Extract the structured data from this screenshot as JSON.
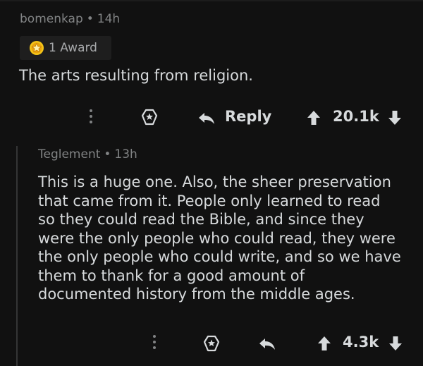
{
  "colors": {
    "background": "#111111",
    "text": "#d7dadc",
    "muted": "#818384",
    "award_badge": "#f5c518",
    "thread_line": "#343536"
  },
  "comment_1": {
    "author": "bomenkap",
    "separator": "•",
    "age": "14h",
    "award_label": "1 Award",
    "award_icon": "star-award-icon",
    "body": "The arts resulting from religion.",
    "actions": {
      "more_icon": "more-vertical-icon",
      "award_icon": "give-award-icon",
      "reply_icon": "reply-arrow-icon",
      "reply_label": "Reply",
      "upvote_icon": "upvote-arrow-icon",
      "score": "20.1k",
      "downvote_icon": "downvote-arrow-icon"
    }
  },
  "comment_2": {
    "author": "Teglement",
    "separator": "•",
    "age": "13h",
    "body_lines": [
      "This is a huge one.  Also, the sheer preservation",
      "that came from it.  People only learned to read",
      "so they could read the Bible, and since they",
      "were the only people who could read, they were",
      "the only people who could write, and so we have",
      "them to thank for a good amount of",
      "documented history from the middle ages."
    ],
    "actions": {
      "more_icon": "more-vertical-icon",
      "award_icon": "give-award-icon",
      "reply_icon": "reply-arrow-icon",
      "upvote_icon": "upvote-arrow-icon",
      "score": "4.3k",
      "downvote_icon": "downvote-arrow-icon"
    }
  }
}
